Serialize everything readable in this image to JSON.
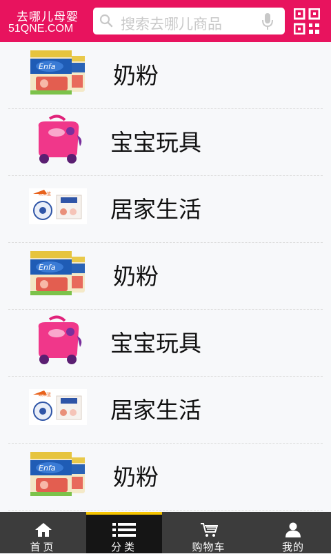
{
  "header": {
    "brand_line1": "去哪儿母婴",
    "brand_line2": "51QNE.COM",
    "search_placeholder": "搜索去哪儿商品",
    "brand_color": "#e8135e"
  },
  "categories": [
    {
      "label": "奶粉",
      "icon": "milk-powder-can"
    },
    {
      "label": "宝宝玩具",
      "icon": "pink-ride-on-suitcase"
    },
    {
      "label": "居家生活",
      "icon": "household-products"
    },
    {
      "label": "奶粉",
      "icon": "milk-powder-can"
    },
    {
      "label": "宝宝玩具",
      "icon": "pink-ride-on-suitcase"
    },
    {
      "label": "居家生活",
      "icon": "household-products"
    },
    {
      "label": "奶粉",
      "icon": "milk-powder-can"
    }
  ],
  "tabbar": {
    "items": [
      {
        "label": "首页",
        "icon": "home-icon"
      },
      {
        "label": "分类",
        "icon": "list-icon",
        "active": true
      },
      {
        "label": "购物车",
        "icon": "cart-icon"
      },
      {
        "label": "我的",
        "icon": "user-icon"
      }
    ],
    "active_indicator_color": "#f5c400"
  }
}
